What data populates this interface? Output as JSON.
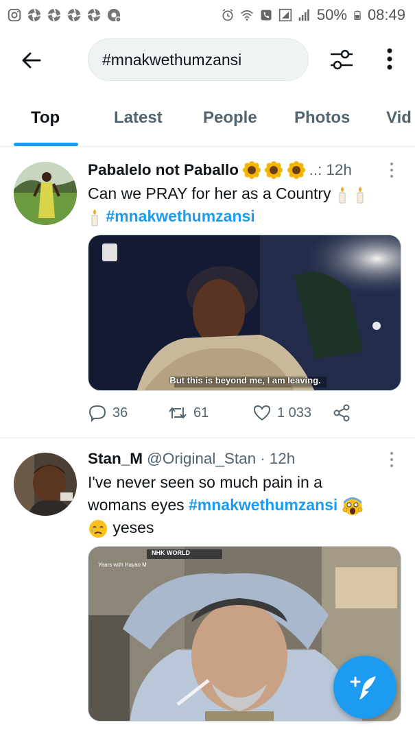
{
  "status_bar": {
    "battery": "50%",
    "time": "08:49"
  },
  "search": {
    "query": "#mnakwethumzansi"
  },
  "tabs": [
    {
      "label": "Top",
      "active": true
    },
    {
      "label": "Latest",
      "active": false
    },
    {
      "label": "People",
      "active": false
    },
    {
      "label": "Photos",
      "active": false
    },
    {
      "label": "Vid",
      "active": false
    }
  ],
  "tweets": [
    {
      "name": "Pabalelo not Paballo",
      "name_suffix": "..:",
      "time": "12h",
      "text": "Can we PRAY for her as a Country",
      "hashtag": "#mnakwethumzansi",
      "media_caption": "But this is beyond me, I am leaving.",
      "replies": "36",
      "retweets": "61",
      "likes": "1 033"
    },
    {
      "name": "Stan_M",
      "handle": "@Original_Stan",
      "separator": "·",
      "time": "12h",
      "text_line1": "I've never seen so much pain in a",
      "text_line2": "womans eyes",
      "hashtag": "#mnakwethumzansi",
      "text_line3": "yeses",
      "media_watermark": "NHK WORLD",
      "media_subtitle": "Years with Hayao M"
    }
  ],
  "colors": {
    "accent": "#1d9bf0",
    "text": "#0f1419",
    "secondary": "#536471"
  }
}
